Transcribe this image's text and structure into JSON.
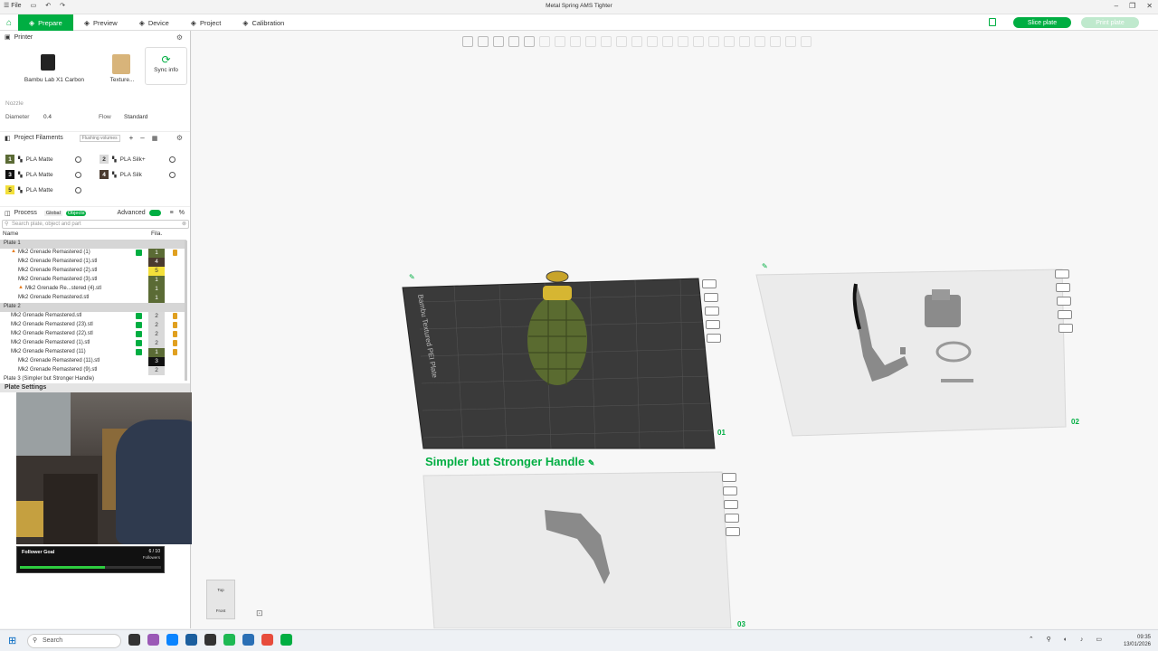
{
  "window": {
    "title": "Metal Spring AMS Tighter",
    "menu_file": "File"
  },
  "nav": {
    "tabs": [
      {
        "label": "Prepare",
        "icon": "prepare-icon",
        "active": true
      },
      {
        "label": "Preview",
        "icon": "preview-icon",
        "active": false
      },
      {
        "label": "Device",
        "icon": "device-icon",
        "active": false
      },
      {
        "label": "Project",
        "icon": "project-icon",
        "active": false
      },
      {
        "label": "Calibration",
        "icon": "calibration-icon",
        "active": false
      }
    ],
    "slice_label": "Slice plate",
    "print_label": "Print plate"
  },
  "printer": {
    "heading": "Printer",
    "printer_name": "Bambu Lab X1 Carbon",
    "plate_type": "Texture...",
    "sync_label": "Sync info",
    "nozzle_label": "Nozzle",
    "diameter_label": "Diameter",
    "diameter_value": "0.4",
    "flow_label": "Flow",
    "flow_value": "Standard"
  },
  "filaments": {
    "heading": "Project Filaments",
    "flushing_label": "Flushing volumes",
    "items": [
      {
        "num": "1",
        "name": "PLA Matte",
        "color": "#5b6b35",
        "text": "#fff"
      },
      {
        "num": "2",
        "name": "PLA Silk+",
        "color": "#d9d9d9",
        "text": "#333"
      },
      {
        "num": "3",
        "name": "PLA Matte",
        "color": "#111111",
        "text": "#fff"
      },
      {
        "num": "4",
        "name": "PLA Silk",
        "color": "#4a3a2e",
        "text": "#fff"
      },
      {
        "num": "5",
        "name": "PLA Matte",
        "color": "#f3e03a",
        "text": "#333"
      }
    ]
  },
  "process": {
    "heading": "Process",
    "global_label": "Global",
    "objects_label": "Objects",
    "advanced_label": "Advanced",
    "search_placeholder": "Search plate, object and part",
    "col_name": "Name",
    "col_fila": "Fila."
  },
  "objects": [
    {
      "name": "Plate 1",
      "indent": 0,
      "fila": "",
      "plate": true
    },
    {
      "name": "Mk2 Grenade Remastered (1)",
      "indent": 1,
      "fila": "1",
      "fcolor": "#5b6b35",
      "chk": true,
      "lock": true,
      "warn": true
    },
    {
      "name": "Mk2 Grenade Remastered (1).stl",
      "indent": 2,
      "fila": "4",
      "fcolor": "#4a3a2e"
    },
    {
      "name": "Mk2 Grenade Remastered (2).stl",
      "indent": 2,
      "fila": "5",
      "fcolor": "#f3e03a"
    },
    {
      "name": "Mk2 Grenade Remastered (3).stl",
      "indent": 2,
      "fila": "1",
      "fcolor": "#5b6b35"
    },
    {
      "name": "Mk2 Grenade Re...stered (4).stl",
      "indent": 2,
      "fila": "1",
      "fcolor": "#5b6b35",
      "warn": true
    },
    {
      "name": "Mk2 Grenade Remastered.stl",
      "indent": 2,
      "fila": "1",
      "fcolor": "#5b6b35"
    },
    {
      "name": "Plate 2",
      "indent": 0,
      "fila": "",
      "plate2": true
    },
    {
      "name": "Mk2 Grenade Remastered.stl",
      "indent": 1,
      "fila": "2",
      "fcolor": "#d9d9d9",
      "chk": true,
      "lock": true
    },
    {
      "name": "Mk2 Grenade Remastered (23).stl",
      "indent": 1,
      "fila": "2",
      "fcolor": "#d9d9d9",
      "chk": true,
      "lock": true
    },
    {
      "name": "Mk2 Grenade Remastered (22).stl",
      "indent": 1,
      "fila": "2",
      "fcolor": "#d9d9d9",
      "chk": true,
      "lock": true
    },
    {
      "name": "Mk2 Grenade Remastered (1).stl",
      "indent": 1,
      "fila": "2",
      "fcolor": "#d9d9d9",
      "chk": true,
      "lock": true
    },
    {
      "name": "Mk2 Grenade Remastered (11)",
      "indent": 1,
      "fila": "1",
      "fcolor": "#5b6b35",
      "chk": true,
      "lock": true
    },
    {
      "name": "Mk2 Grenade Remastered (11).stl",
      "indent": 2,
      "fila": "3",
      "fcolor": "#111111"
    },
    {
      "name": "Mk2 Grenade Remastered (9).stl",
      "indent": 2,
      "fila": "2",
      "fcolor": "#d9d9d9"
    },
    {
      "name": "Plate 3 (Simpler but Stronger Handle)",
      "indent": 0,
      "fila": ""
    }
  ],
  "plate_settings": "Plate Settings",
  "stream": {
    "follower_label": "Follower Goal",
    "follower_count": "6 / 10",
    "follower_sub": "Followers",
    "progress": 0.6
  },
  "scene": {
    "plate1_num": "01",
    "plate2_num": "02",
    "plate3_num": "03",
    "plate1_bed_label": "Bambu Textured PEI Plate",
    "plate3_title": "Simpler but Stronger Handle",
    "view_top": "Top",
    "view_front": "Front"
  },
  "taskbar": {
    "search": "Search",
    "time": "09:35",
    "date": "13/01/2026"
  }
}
